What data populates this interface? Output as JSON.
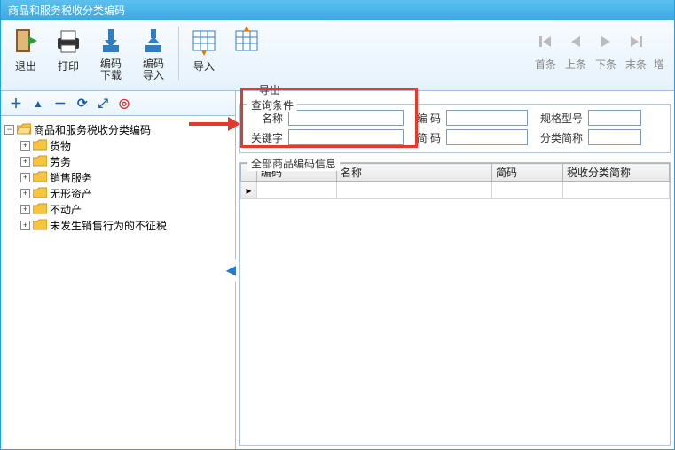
{
  "window": {
    "title": "商品和服务税收分类编码"
  },
  "toolbar": {
    "exit": "退出",
    "print": "打印",
    "code_download": "编码\n下载",
    "code_import": "编码\n导入",
    "import": "导入",
    "export": "导出"
  },
  "nav": {
    "first": "首条",
    "prev": "上条",
    "next": "下条",
    "last": "末条",
    "extra": "增"
  },
  "mini_toolbar": {
    "add": "＋",
    "up": "▲",
    "remove": "－",
    "refresh": "⟳",
    "expand": "⤢",
    "target": "◎"
  },
  "tree": {
    "root": "商品和服务税收分类编码",
    "children": [
      "货物",
      "劳务",
      "销售服务",
      "无形资产",
      "不动产",
      "未发生销售行为的不征税"
    ]
  },
  "floating_label": "导出",
  "filter": {
    "legend": "查询条件",
    "name_label": "名称",
    "code_label": "编 码",
    "spec_label": "规格型号",
    "keyword_label": "关键字",
    "shortcode_label": "简 码",
    "catshort_label": "分类简称"
  },
  "grid": {
    "legend": "全部商品编码信息",
    "cols": [
      "编码",
      "名称",
      "简码",
      "税收分类简称"
    ]
  },
  "collapse_glyph": "◀"
}
